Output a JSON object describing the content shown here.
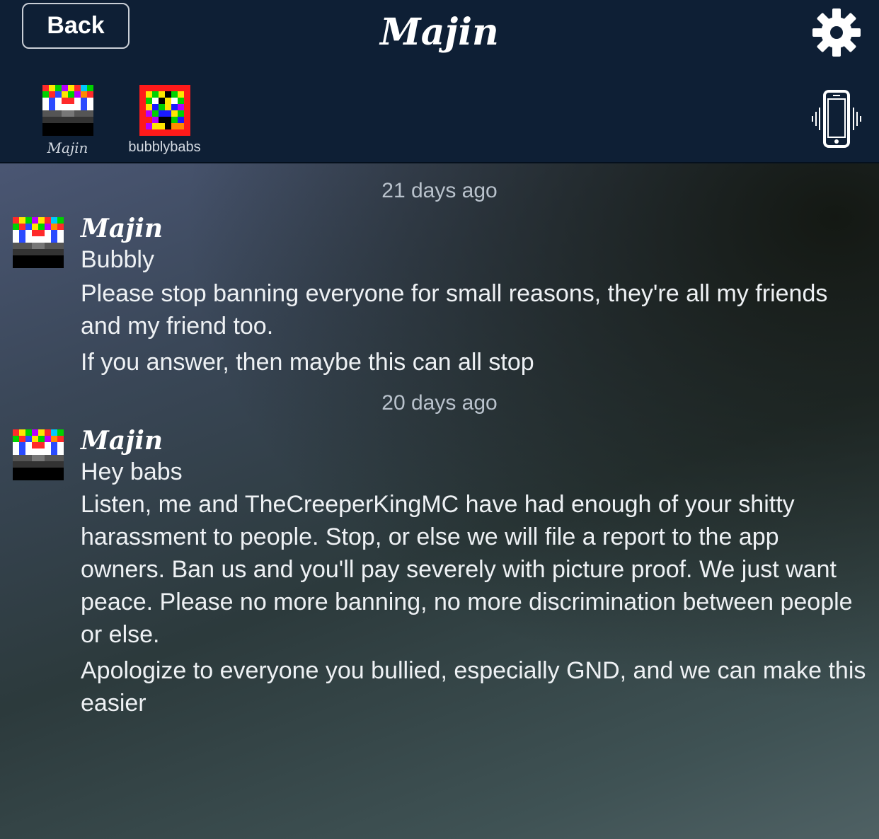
{
  "header": {
    "back_label": "Back",
    "title": "Majin",
    "members": [
      {
        "label": "Majin"
      },
      {
        "label": "bubblybabs"
      }
    ]
  },
  "messages": [
    {
      "timestamp": "21 days ago",
      "author": "Majin",
      "lines": [
        "Bubbly",
        "Please stop banning everyone for small reasons, they're all my friends and my friend too.",
        "If you answer, then maybe this can all stop"
      ]
    },
    {
      "timestamp": "20 days ago",
      "author": "Majin",
      "lines": [
        "Hey babs",
        "Listen, me and TheCreeperKingMC have had enough of your shitty harassment to people. Stop, or else we will file a report to the app owners. Ban us and you'll pay severely with picture proof. We just want peace. Please no more banning, no more discrimination between people or else.",
        "Apologize to everyone you bullied, especially GND, and we can make this easier"
      ]
    }
  ],
  "icons": {
    "settings": "gear-icon",
    "vibrate": "phone-vibrate-icon"
  }
}
